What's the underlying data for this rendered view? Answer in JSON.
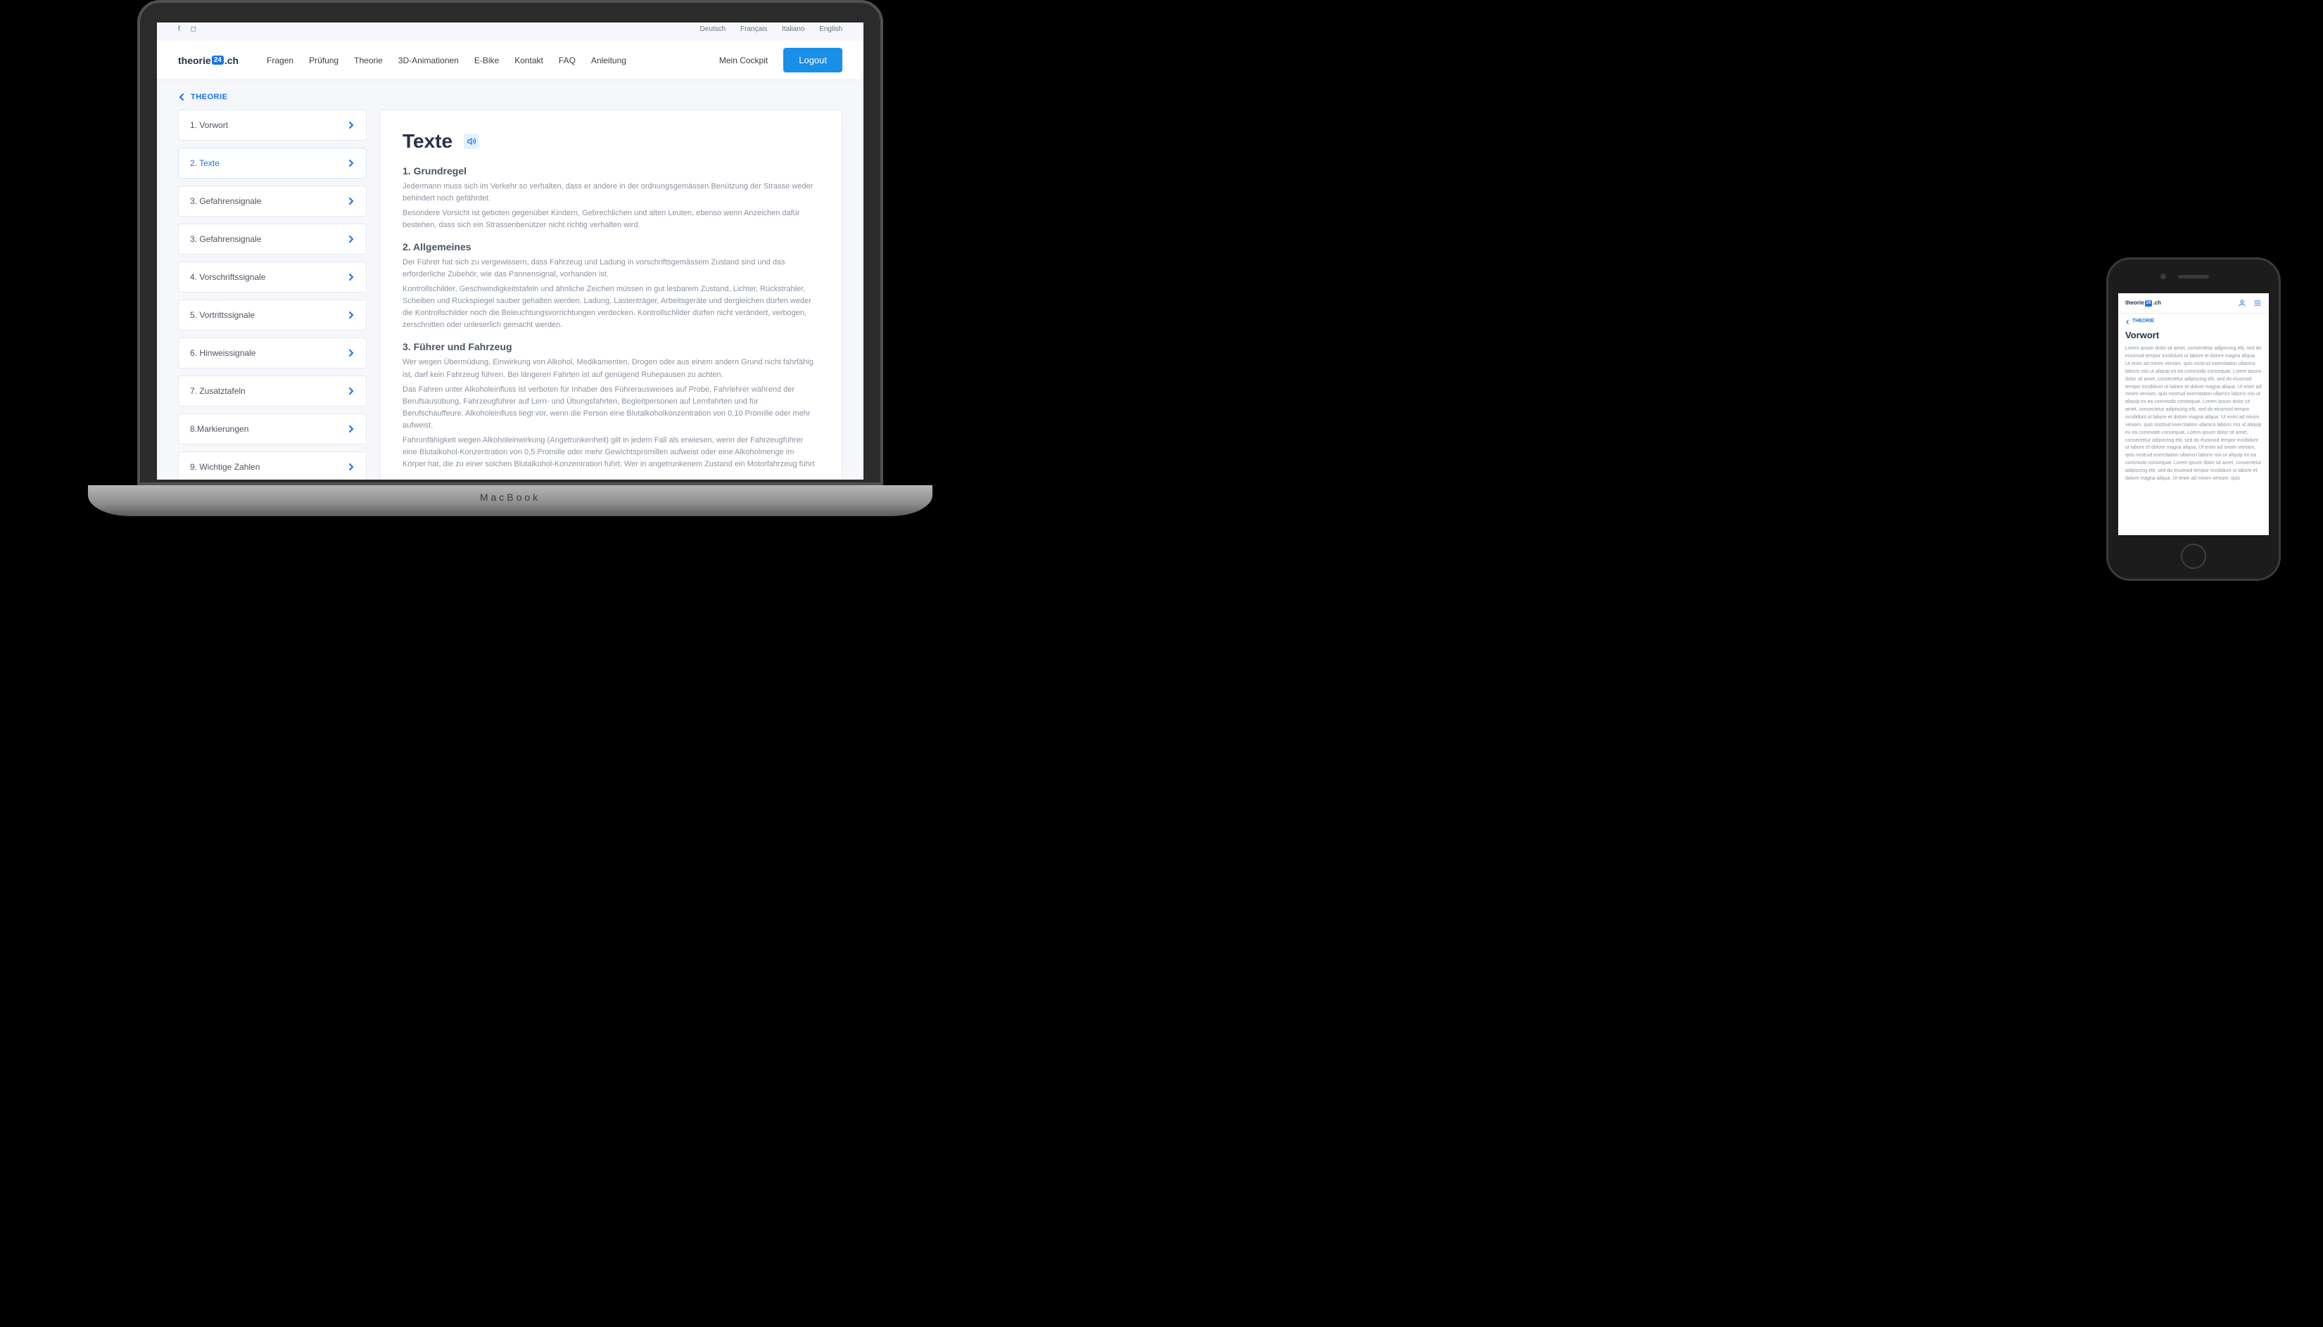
{
  "brand": {
    "pre": "theorie",
    "badge": "24",
    "post": ".ch"
  },
  "topbar": {
    "langs": [
      "Deutsch",
      "Français",
      "Italiano",
      "English"
    ]
  },
  "menu": [
    "Fragen",
    "Prüfung",
    "Theorie",
    "3D-Animationen",
    "E-Bike",
    "Kontakt",
    "FAQ",
    "Anleitung"
  ],
  "cockpit": "Mein Cockpit",
  "logout": "Logout",
  "breadcrumb": "THEORIE",
  "sidebar": [
    {
      "label": "1. Vorwort"
    },
    {
      "label": "2. Texte",
      "active": true
    },
    {
      "label": "3. Gefahrensignale"
    },
    {
      "label": "3. Gefahrensignale"
    },
    {
      "label": "4. Vorschriftssignale"
    },
    {
      "label": "5. Vortrittssignale"
    },
    {
      "label": "6. Hinweissignale"
    },
    {
      "label": "7. Zusatztafeln"
    },
    {
      "label": "8.Markierungen"
    },
    {
      "label": "9. Wichtige Zahlen"
    }
  ],
  "content": {
    "title": "Texte",
    "sections": [
      {
        "heading": "1. Grundregel",
        "paragraphs": [
          "Jedermann muss sich im Verkehr so verhalten, dass er andere in der ordnungsgemässen Benützung der Strasse weder behindert noch gefährdet.",
          "Besondere Vorsicht ist geboten gegenüber Kindern, Gebrechlichen und alten Leuten, ebenso wenn Anzeichen dafür bestehen, dass sich ein Strassenbenützer nicht richtig verhalten wird."
        ]
      },
      {
        "heading": "2. Allgemeines",
        "paragraphs": [
          "Der Führer hat sich zu vergewissern, dass Fahrzeug und Ladung in vorschriftsgemässem Zustand sind und das erforderliche Zubehör, wie das Pannensignal, vorhanden ist.",
          "Kontrollschilder, Geschwindigkeitstafeln und ähnliche Zeichen müssen in gut lesbarem Zustand, Lichter, Rückstrahler, Scheiben und Rückspiegel sauber gehalten werden. Ladung, Lastenträger, Arbeitsgeräte und dergleichen dürfen weder die Kontrollschilder noch die Beleuchtungsvorrichtungen verdecken. Kontrollschilder dürfen nicht verändert, verbogen, zerschnitten oder unleserlich gemacht werden."
        ]
      },
      {
        "heading": "3. Führer und Fahrzeug",
        "paragraphs": [
          "Wer wegen Übermüdung, Einwirkung von Alkohol, Medikamenten, Drogen oder aus einem andern Grund nicht fahrfähig ist, darf kein Fahrzeug führen. Bei längeren Fahrten ist auf genügend Ruhepausen zu achten.",
          "Das Fahren unter Alkoholeinfluss ist verboten für Inhaber des Führerausweises auf Probe, Fahrlehrer während der Berufsausübung, Fahrzeugführer auf Lern- und Übungsfahrten, Begleitpersonen auf Lernfahrten und für Berufschauffeure. Alkoholeinfluss liegt vor, wenn die Person eine Blutalkoholkonzentration von 0,10 Promille oder mehr aufweist.",
          "Fahrunfähigkeit wegen Alkoholeinwirkung (Angetrunkenheit) gilt in jedem Fall als erwiesen, wenn der Fahrzeugführer eine Blutalkohol-Konzentration von 0,5 Promille oder mehr Gewichtspromillen aufweist oder eine Alkoholmenge im Körper hat, die zu einer solchen Blutalkohol-Konzentration führt. Wer in angetrunkenem Zustand ein Motorfahrzeug führt"
        ]
      }
    ]
  },
  "phone": {
    "breadcrumb": "THEORIE",
    "title": "Vorwort",
    "body": "Lorem ipsum dolor sit amet, consectetur adipiscing elit, sed do eiusmod tempor incididunt ut labore et dolore magna aliqua. Ut enim ad minim veniam, quis nostrud exercitation ullamco laboris nisi ut aliquip ex ea commodo consequat. Lorem ipsum dolor sit amet, consectetur adipiscing elit, sed do eiusmod tempor incididunt ut labore et dolore magna aliqua. Ut enim ad minim veniam, quis nostrud exercitation ullamco laboris nisi ut aliquip ex ea commodo consequat. Lorem ipsum dolor sit amet, consectetur adipiscing elit, sed do eiusmod tempor incididunt ut labore et dolore magna aliqua. Ut enim ad minim veniam, quis nostrud exercitation ullamco laboris nisi ut aliquip ex ea commodo consequat. Lorem ipsum dolor sit amet, consectetur adipiscing elit, sed do eiusmod tempor incididunt ut labore et dolore magna aliqua. Ut enim ad minim veniam, quis nostrud exercitation ullamco laboris nisi ut aliquip ex ea commodo consequat. Lorem ipsum dolor sit amet, consectetur adipiscing elit, sed do eiusmod tempor incididunt ut labore et dolore magna aliqua. Ut enim ad minim veniam, quis"
  },
  "macbook_label": "MacBook"
}
